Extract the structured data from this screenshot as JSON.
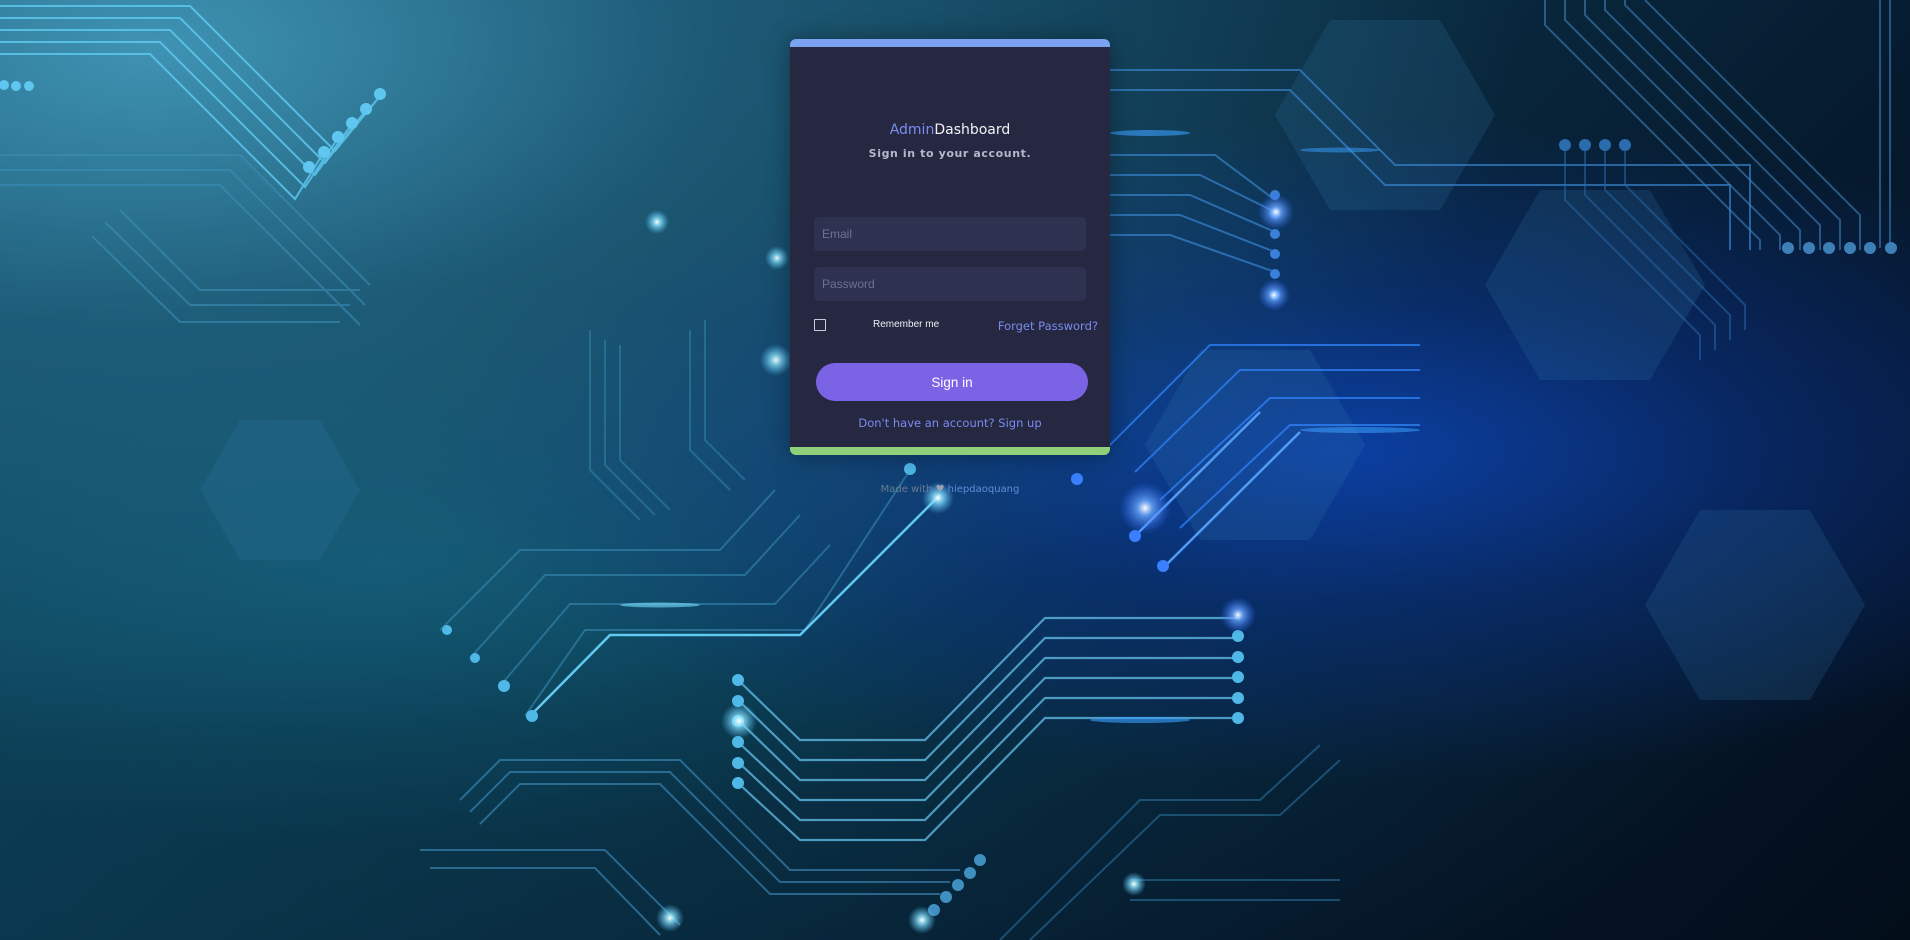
{
  "login": {
    "brand_accent": "Admin",
    "brand_rest": "Dashboard",
    "subtitle": "Sign in to your account.",
    "email_placeholder": "Email",
    "password_placeholder": "Password",
    "remember_label": "Remember me",
    "forgot_label": "Forget Password?",
    "signin_label": "Sign in",
    "signup_label": "Don't have an account? Sign up"
  },
  "footer": {
    "credit_prefix": "Made with",
    "credit_author": "hiepdaoquang"
  },
  "icons": {
    "heart": "heart-icon",
    "checkbox": "checkbox-icon"
  },
  "colors": {
    "card_bg": "#252840",
    "accent": "#7a8cf0",
    "button": "#7b63e6",
    "top_bar": "#7aa2f0",
    "bottom_bar": "#8fd17a"
  }
}
